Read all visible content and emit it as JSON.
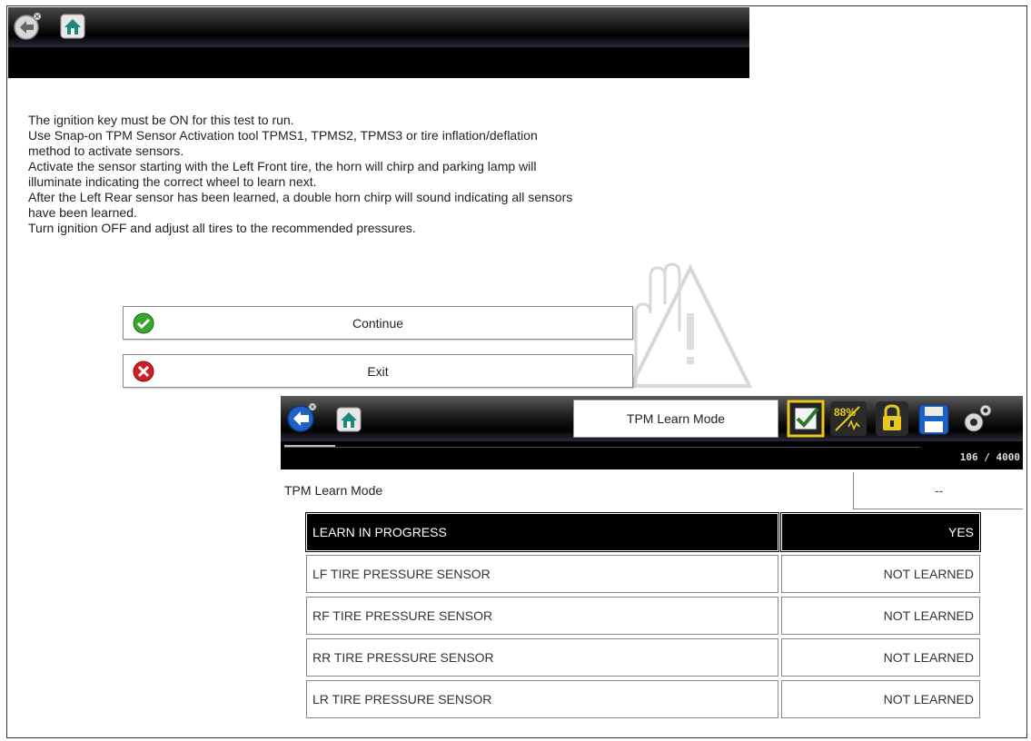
{
  "top_screen": {
    "instructions": [
      "The ignition key must be ON for this test to run.",
      "Use Snap-on TPM Sensor Activation tool TPMS1, TPMS2, TPMS3 or tire inflation/deflation",
      "method to activate sensors.",
      "Activate the sensor starting with the Left Front tire, the horn will chirp and parking lamp will",
      "illuminate indicating the correct wheel to learn next.",
      "After the Left Rear sensor has been learned, a double horn chirp will sound indicating all sensors",
      "have been learned.",
      "Turn ignition OFF and adjust all tires to the recommended pressures."
    ],
    "continue_label": "Continue",
    "exit_label": "Exit"
  },
  "bottom_screen": {
    "title": "TPM Learn Mode",
    "battery_label": "88%",
    "counter": "106 / 4000",
    "mode_row": {
      "label": "TPM Learn Mode",
      "value": "--"
    },
    "rows": [
      {
        "name": "LEARN IN PROGRESS",
        "value": "YES",
        "highlight": true
      },
      {
        "name": "LF TIRE PRESSURE SENSOR",
        "value": "NOT LEARNED",
        "highlight": false
      },
      {
        "name": "RF TIRE PRESSURE SENSOR",
        "value": "NOT LEARNED",
        "highlight": false
      },
      {
        "name": "RR TIRE PRESSURE SENSOR",
        "value": "NOT LEARNED",
        "highlight": false
      },
      {
        "name": "LR TIRE PRESSURE SENSOR",
        "value": "NOT LEARNED",
        "highlight": false
      }
    ]
  },
  "colors": {
    "check_green": "#3aa42e",
    "exit_red": "#d01f24",
    "icon_blue": "#1e62c8",
    "home_teal": "#1a8a7a",
    "highlight_yellow": "#e8c820"
  }
}
